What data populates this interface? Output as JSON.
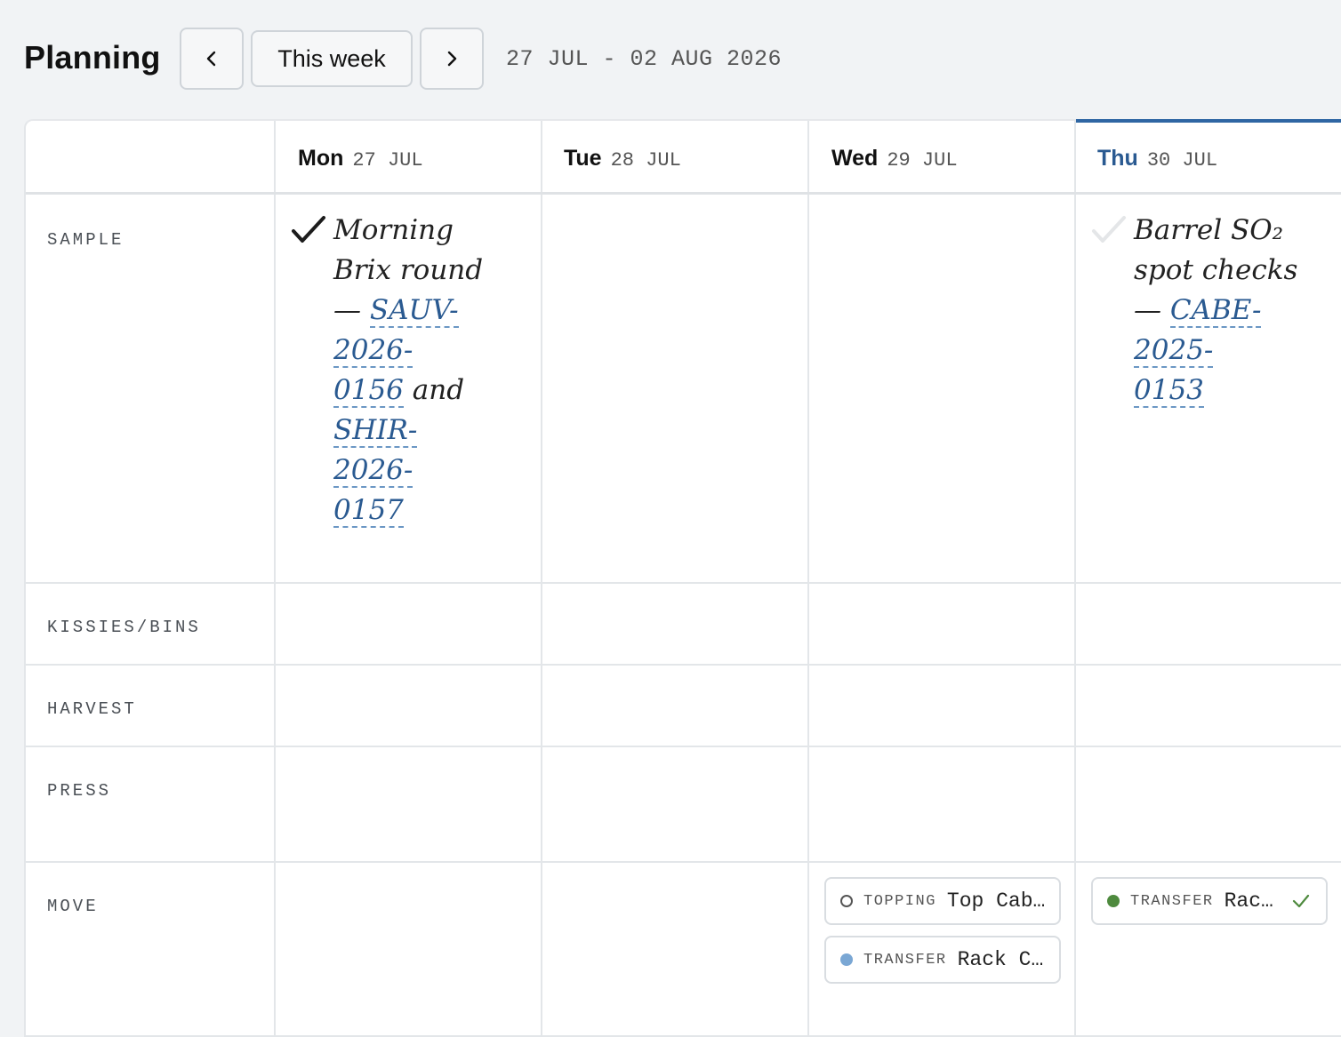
{
  "header": {
    "title": "Planning",
    "today_label": "This week",
    "date_range": "27 JUL - 02 AUG 2026"
  },
  "days": [
    {
      "name": "Mon",
      "date": "27 JUL",
      "today": false
    },
    {
      "name": "Tue",
      "date": "28 JUL",
      "today": false
    },
    {
      "name": "Wed",
      "date": "29 JUL",
      "today": false
    },
    {
      "name": "Thu",
      "date": "30 JUL",
      "today": true
    }
  ],
  "rows": [
    "SAMPLE",
    "KISSIES/BINS",
    "HARVEST",
    "PRESS",
    "MOVE"
  ],
  "tasks": {
    "mon_sample": {
      "done": true,
      "text_1": "Morning",
      "text_2": "Brix round",
      "dash": "—",
      "ref_1a": "SAUV-",
      "ref_1b": "2026-",
      "ref_1c": "0156",
      "and": "and",
      "ref_2a": "SHIR-",
      "ref_2b": "2026-",
      "ref_2c": "0157"
    },
    "thu_sample": {
      "done": false,
      "text_1": "Barrel SO₂",
      "text_2": "spot checks",
      "dash": "—",
      "ref_1a": "CABE-",
      "ref_1b": "2025-",
      "ref_1c": "0153"
    }
  },
  "moves": {
    "wed": [
      {
        "type": "TOPPING",
        "label": "Top Cab…",
        "dot": "hollow",
        "dot_color": "#555555"
      },
      {
        "type": "TRANSFER",
        "label": "Rack C…",
        "dot": "filled",
        "dot_color": "#7aa7d4"
      }
    ],
    "thu": [
      {
        "type": "TRANSFER",
        "label": "Rac…",
        "dot": "filled",
        "dot_color": "#4e8a3e",
        "done": true
      }
    ]
  },
  "colors": {
    "accent": "#2f66a3",
    "ref_link": "#2a5a91",
    "done_check": "#4e8a3e"
  }
}
